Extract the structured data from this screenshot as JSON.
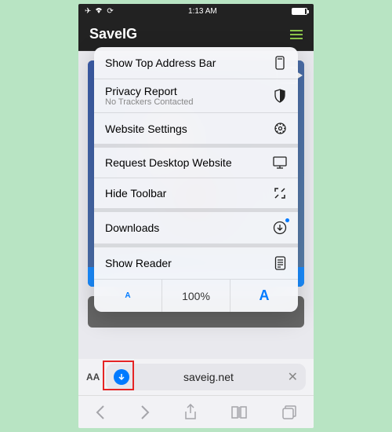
{
  "statusBar": {
    "time": "1:13 AM"
  },
  "header": {
    "title": "SaveIG"
  },
  "menu": {
    "items": [
      {
        "label": "Show Top Address Bar",
        "icon": "address-bar",
        "sep": false
      },
      {
        "label": "Privacy Report",
        "sublabel": "No Trackers Contacted",
        "icon": "shield",
        "sep": false
      },
      {
        "label": "Website Settings",
        "icon": "gear",
        "sep": true
      },
      {
        "label": "Request Desktop Website",
        "icon": "desktop",
        "sep": false
      },
      {
        "label": "Hide Toolbar",
        "icon": "expand",
        "sep": true
      },
      {
        "label": "Downloads",
        "icon": "download",
        "sep": true
      },
      {
        "label": "Show Reader",
        "icon": "reader",
        "sep": false
      }
    ],
    "zoom": {
      "smaller": "A",
      "percent": "100%",
      "larger": "A"
    }
  },
  "urlBar": {
    "aa": "AA",
    "url": "saveig.net"
  }
}
